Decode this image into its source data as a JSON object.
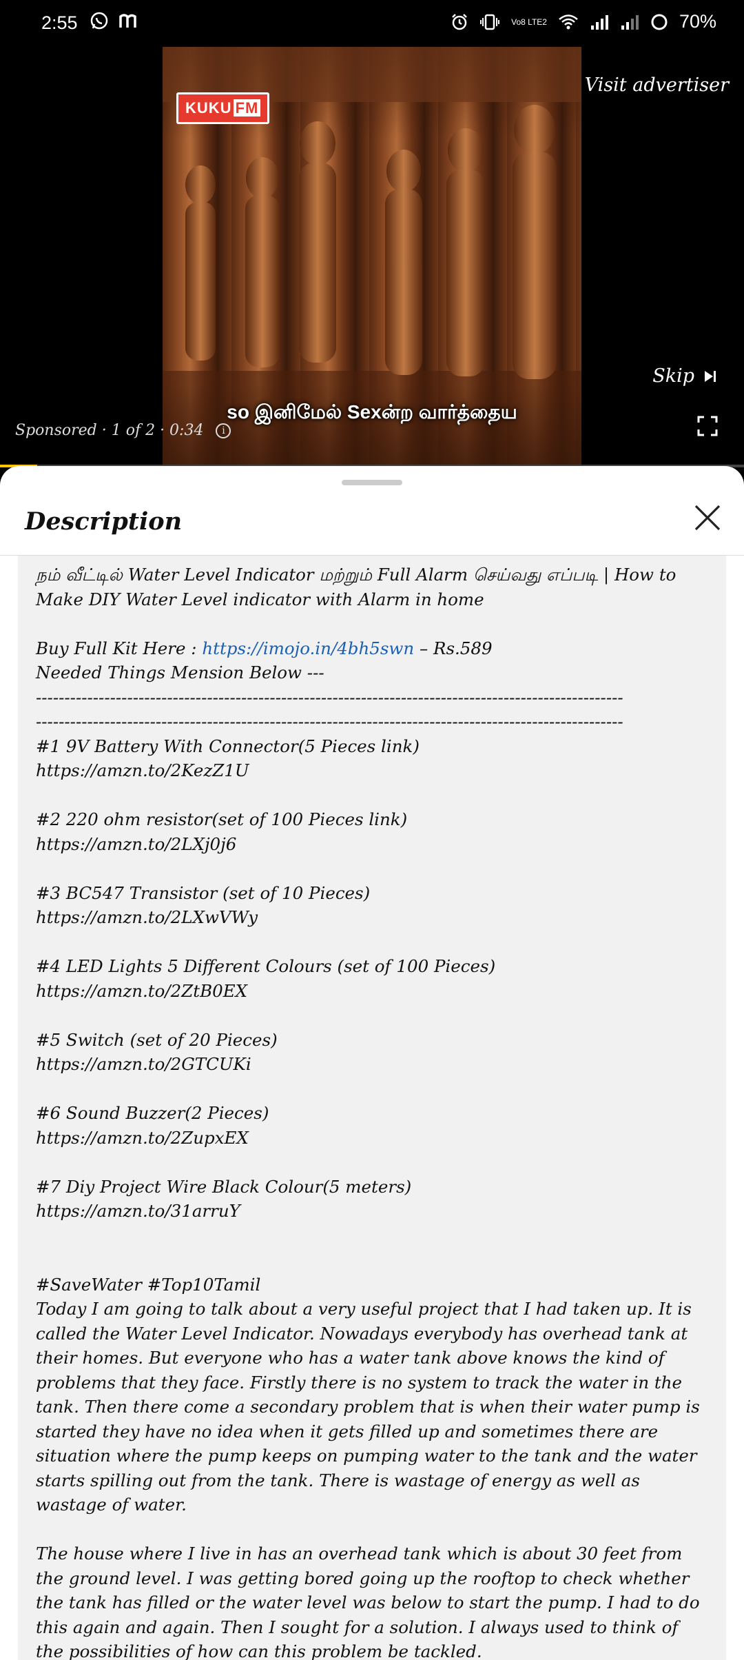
{
  "status_bar": {
    "time": "2:55",
    "battery": "70%",
    "icons": [
      "whatsapp-icon",
      "m-icon",
      "alarm-icon",
      "vibrate-icon",
      "volte-icon",
      "wifi-icon",
      "signal-icon",
      "signal-2-icon",
      "battery-icon"
    ],
    "volte_label": "Vo8 LTE2"
  },
  "video_ad": {
    "brand_logo_left": "KUKU",
    "brand_logo_right": "FM",
    "visit_advertiser": "Visit advertiser",
    "skip_label": "Skip",
    "subtitle": "so இனிமேல் Sexன்ற வார்த்தைய",
    "sponsored_text": "Sponsored · 1 of 2 · 0:34",
    "progress": 0.05,
    "accent_color": "#ffc400"
  },
  "description_sheet": {
    "title": "Description",
    "lines": {
      "title_line": "நம் வீட்டில் Water Level Indicator மற்றும் Full Alarm செய்வது எப்படி | How to Make DIY Water Level indicator with Alarm in home",
      "buy_prefix": "Buy Full Kit Here : ",
      "buy_link": "https://imojo.in/4bh5swn",
      "buy_suffix": " – Rs.589",
      "needed": "Needed Things Mension Below ---",
      "dash1": "-------------------------------------------------------------------------------------------------------",
      "dash2": "-------------------------------------------------------------------------------------------------------"
    },
    "items": [
      {
        "name": "#1 9V Battery With Connector(5 Pieces link)",
        "link": "https://amzn.to/2KezZ1U"
      },
      {
        "name": "#2 220 ohm resistor(set of 100 Pieces link)",
        "link": "https://amzn.to/2LXj0j6"
      },
      {
        "name": "#3 BC547 Transistor (set of 10 Pieces)",
        "link": "https://amzn.to/2LXwVWy"
      },
      {
        "name": "#4 LED Lights 5 Different Colours (set of 100 Pieces)",
        "link": "https://amzn.to/2ZtB0EX"
      },
      {
        "name": "#5 Switch (set of 20 Pieces)",
        "link": "https://amzn.to/2GTCUKi"
      },
      {
        "name": "#6 Sound Buzzer(2 Pieces)",
        "link": "https://amzn.to/2ZupxEX"
      },
      {
        "name": "#7 Diy Project Wire Black Colour(5 meters)",
        "link": "https://amzn.to/31arruY"
      }
    ],
    "hashtags": "#SaveWater #Top10Tamil",
    "paragraph1": "Today I am going to talk about a very useful project that I had taken up. It is called the Water Level Indicator. Nowadays everybody has overhead tank at their homes. But everyone who has a water tank above knows the kind of problems that they face. Firstly there is no system to track the water in the tank. Then there come a secondary problem that is when their water pump is started they have no idea when it gets filled up and sometimes there are situation where the pump keeps on pumping water to the tank and the water starts spilling out from the tank. There is wastage of energy as well as wastage of water.",
    "paragraph2": "The house where I live in has an overhead tank which is about 30 feet from the ground level. I was getting bored going up the rooftop to check whether the tank has filled or the water level was below to start the pump. I had to do this again and again. Then I sought for a solution. I always used to think of the possibilities of how can this problem be tackled."
  }
}
